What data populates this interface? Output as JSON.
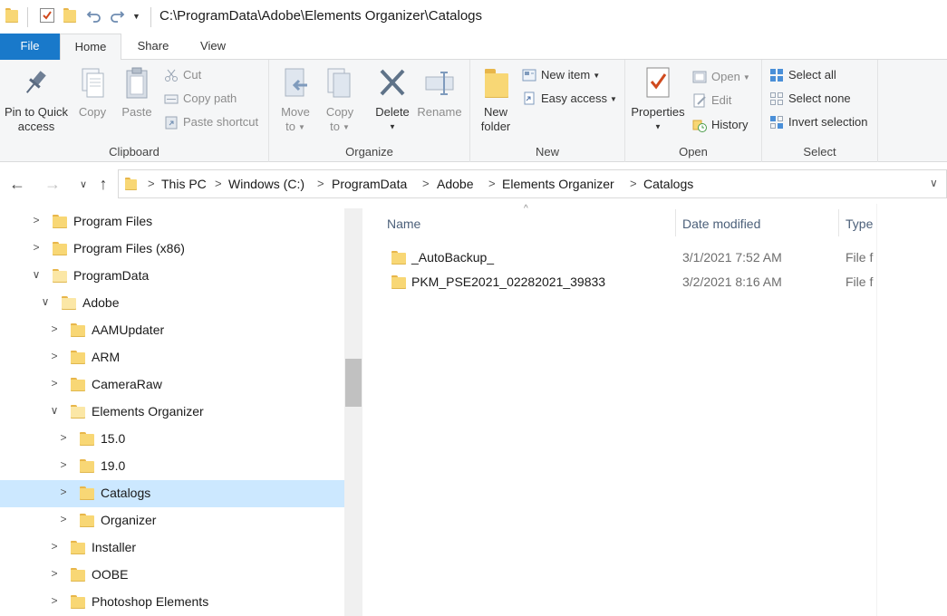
{
  "window": {
    "title": "C:\\ProgramData\\Adobe\\Elements Organizer\\Catalogs"
  },
  "ribbon_tabs": [
    "File",
    "Home",
    "Share",
    "View"
  ],
  "ribbon": {
    "clipboard": {
      "label": "Clipboard",
      "pin_line1": "Pin to Quick",
      "pin_line2": "access",
      "copy": "Copy",
      "paste": "Paste",
      "cut": "Cut",
      "copy_path": "Copy path",
      "paste_shortcut": "Paste shortcut"
    },
    "organize": {
      "label": "Organize",
      "move_line1": "Move",
      "move_line2": "to",
      "copy_line1": "Copy",
      "copy_line2": "to",
      "delete": "Delete",
      "rename": "Rename"
    },
    "new": {
      "label": "New",
      "folder_line1": "New",
      "folder_line2": "folder",
      "new_item": "New item",
      "easy_access": "Easy access"
    },
    "open": {
      "label": "Open",
      "properties": "Properties",
      "open": "Open",
      "edit": "Edit",
      "history": "History"
    },
    "select": {
      "label": "Select",
      "select_all": "Select all",
      "select_none": "Select none",
      "invert_selection": "Invert selection"
    }
  },
  "breadcrumb": [
    "This PC",
    "Windows (C:)",
    "ProgramData",
    "Adobe",
    "Elements Organizer",
    "Catalogs"
  ],
  "tree": [
    {
      "label": "Program Files",
      "expanded": false,
      "level": 0,
      "selected": false,
      "open_folder": false
    },
    {
      "label": "Program Files (x86)",
      "expanded": false,
      "level": 0,
      "selected": false,
      "open_folder": false
    },
    {
      "label": "ProgramData",
      "expanded": true,
      "level": 0,
      "selected": false,
      "open_folder": true
    },
    {
      "label": "Adobe",
      "expanded": true,
      "level": 1,
      "selected": false,
      "open_folder": true
    },
    {
      "label": "AAMUpdater",
      "expanded": false,
      "level": 2,
      "selected": false,
      "open_folder": false
    },
    {
      "label": "ARM",
      "expanded": false,
      "level": 2,
      "selected": false,
      "open_folder": false
    },
    {
      "label": "CameraRaw",
      "expanded": false,
      "level": 2,
      "selected": false,
      "open_folder": false
    },
    {
      "label": "Elements Organizer",
      "expanded": true,
      "level": 2,
      "selected": false,
      "open_folder": true
    },
    {
      "label": "15.0",
      "expanded": false,
      "level": 3,
      "selected": false,
      "open_folder": false
    },
    {
      "label": "19.0",
      "expanded": false,
      "level": 3,
      "selected": false,
      "open_folder": false
    },
    {
      "label": "Catalogs",
      "expanded": false,
      "level": 3,
      "selected": true,
      "open_folder": false
    },
    {
      "label": "Organizer",
      "expanded": false,
      "level": 3,
      "selected": false,
      "open_folder": false
    },
    {
      "label": "Installer",
      "expanded": false,
      "level": 2,
      "selected": false,
      "open_folder": false
    },
    {
      "label": "OOBE",
      "expanded": false,
      "level": 2,
      "selected": false,
      "open_folder": false
    },
    {
      "label": "Photoshop Elements",
      "expanded": false,
      "level": 2,
      "selected": false,
      "open_folder": false
    }
  ],
  "columns": {
    "name": "Name",
    "date_modified": "Date modified",
    "type": "Type"
  },
  "files": [
    {
      "name": "_AutoBackup_",
      "date": "3/1/2021 7:52 AM",
      "type": "File f"
    },
    {
      "name": "PKM_PSE2021_02282021_39833",
      "date": "3/2/2021 8:16 AM",
      "type": "File f"
    }
  ],
  "colors": {
    "accent": "#1979ca",
    "selection": "#cce8ff",
    "folder": "#f8d775"
  }
}
